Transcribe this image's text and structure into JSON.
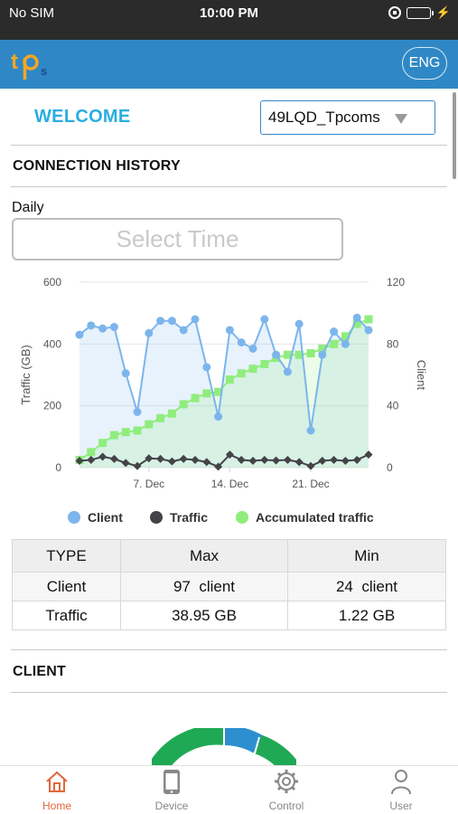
{
  "status_bar": {
    "carrier": "No SIM",
    "time": "10:00 PM"
  },
  "header": {
    "language_button": "ENG"
  },
  "welcome": "WELCOME",
  "network_select": {
    "value": "49LQD_Tpcoms"
  },
  "connection_history": {
    "title": "CONNECTION HISTORY",
    "period_label": "Daily",
    "time_placeholder": "Select Time"
  },
  "chart_data": {
    "type": "line",
    "x_tick_labels": [
      "7. Dec",
      "14. Dec",
      "21. Dec"
    ],
    "x_tick_positions": [
      6,
      13,
      20
    ],
    "ylabel_left": "Traffic (GB)",
    "ylabel_right": "Client",
    "ylim_left": [
      0,
      600
    ],
    "ylim_right": [
      0,
      120
    ],
    "yticks_left": [
      "0",
      "200",
      "400",
      "600"
    ],
    "yticks_right": [
      "0",
      "40",
      "80",
      "120"
    ],
    "legend_placement": "bottom",
    "series": [
      {
        "name": "Client",
        "axis": "right",
        "color": "#7cb5ec",
        "marker": "circle",
        "values": [
          86,
          92,
          90,
          91,
          61,
          36,
          87,
          95,
          95,
          89,
          96,
          65,
          33,
          89,
          81,
          77,
          96,
          73,
          62,
          93,
          24,
          73,
          88,
          80,
          97,
          89
        ]
      },
      {
        "name": "Traffic",
        "axis": "left",
        "color": "#434348",
        "marker": "diamond",
        "values": [
          22,
          25,
          35,
          28,
          15,
          5,
          30,
          28,
          20,
          28,
          25,
          18,
          3,
          42,
          25,
          22,
          25,
          23,
          25,
          18,
          5,
          22,
          25,
          22,
          25,
          42
        ]
      },
      {
        "name": "Accumulated traffic",
        "axis": "left",
        "color": "#90ed7d",
        "marker": "square",
        "values": [
          25,
          50,
          80,
          105,
          115,
          120,
          140,
          160,
          175,
          205,
          225,
          240,
          245,
          285,
          305,
          320,
          335,
          355,
          365,
          365,
          370,
          385,
          400,
          425,
          465,
          480
        ]
      }
    ]
  },
  "stats_table": {
    "headers": [
      "TYPE",
      "Max",
      "Min"
    ],
    "rows": [
      [
        "Client",
        "97  client",
        "24  client"
      ],
      [
        "Traffic",
        "38.95 GB",
        "1.22 GB"
      ]
    ]
  },
  "client_section": {
    "title": "CLIENT"
  },
  "tabs": [
    {
      "label": "Home",
      "icon": "home-icon"
    },
    {
      "label": "Device",
      "icon": "device-icon"
    },
    {
      "label": "Control",
      "icon": "gear-icon"
    },
    {
      "label": "User",
      "icon": "user-icon"
    }
  ]
}
